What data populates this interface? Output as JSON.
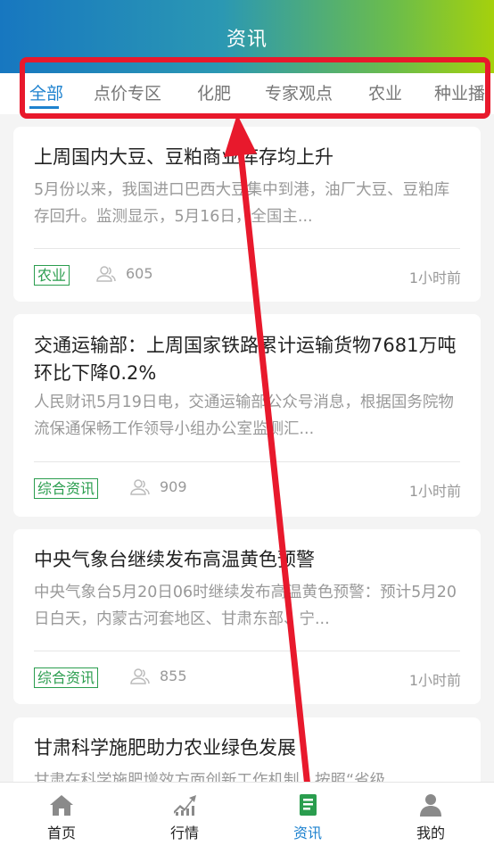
{
  "header": {
    "title": "资讯"
  },
  "tabs": [
    {
      "label": "全部",
      "active": true
    },
    {
      "label": "点价专区"
    },
    {
      "label": "化肥"
    },
    {
      "label": "专家观点"
    },
    {
      "label": "农业"
    },
    {
      "label": "种业播"
    }
  ],
  "articles": [
    {
      "title": "上周国内大豆、豆粕商业库存均上升",
      "summary": "5月份以来，我国进口巴西大豆集中到港，油厂大豆、豆粕库存回升。监测显示，5月16日，全国主...",
      "tag": "农业",
      "views": "605",
      "time": "1小时前"
    },
    {
      "title": "交通运输部：上周国家铁路累计运输货物7681万吨 环比下降0.2%",
      "summary": "人民财讯5月19日电，交通运输部公众号消息，根据国务院物流保通保畅工作领导小组办公室监测汇...",
      "tag": "综合资讯",
      "views": "909",
      "time": "1小时前"
    },
    {
      "title": "中央气象台继续发布高温黄色预警",
      "summary": "中央气象台5月20日06时继续发布高温黄色预警：预计5月20日白天，内蒙古河套地区、甘肃东部、宁...",
      "tag": "综合资讯",
      "views": "855",
      "time": "1小时前"
    },
    {
      "title": "甘肃科学施肥助力农业绿色发展",
      "summary": "甘肃在科学施肥增效方面创新工作机制，按照“省级"
    }
  ],
  "bottom_nav": [
    {
      "label": "首页",
      "icon": "home-icon"
    },
    {
      "label": "行情",
      "icon": "trend-chart-icon"
    },
    {
      "label": "资讯",
      "icon": "news-icon",
      "active": true
    },
    {
      "label": "我的",
      "icon": "user-icon"
    }
  ],
  "colors": {
    "accent": "#1e82cf",
    "tag_green": "#2a9d4e",
    "annotation_red": "#e8192c",
    "header_gradient_start": "#1777c0",
    "header_gradient_end": "#a5d10c"
  }
}
